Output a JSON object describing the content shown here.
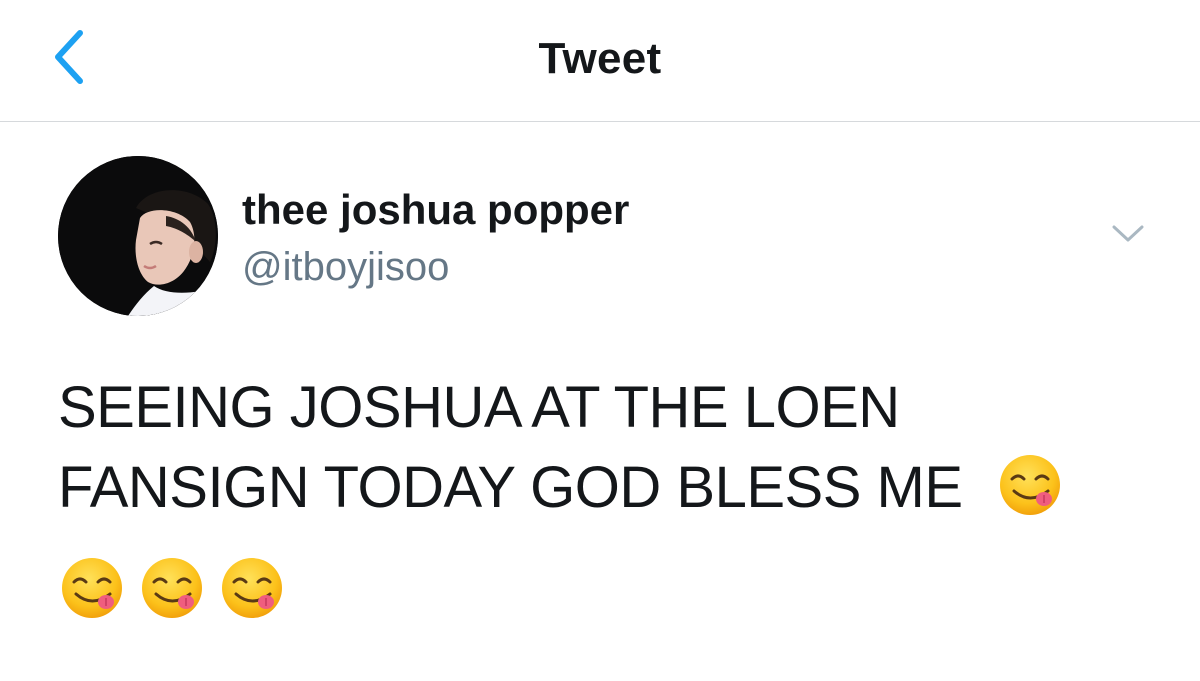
{
  "nav": {
    "title": "Tweet",
    "back_icon": "chevron-left-icon"
  },
  "author": {
    "display_name": "thee joshua popper",
    "handle": "@itboyjisoo",
    "more_icon": "chevron-down-icon"
  },
  "tweet": {
    "text_line1": "SEEING JOSHUA AT THE LOEN",
    "text_line2": "FANSIGN TODAY GOD BLESS ME",
    "emoji": "face-savoring-food",
    "emoji_count": 4
  },
  "colors": {
    "accent": "#1da1f2",
    "text": "#14171a",
    "secondary_text": "#657786",
    "divider": "#d6d9dc"
  }
}
